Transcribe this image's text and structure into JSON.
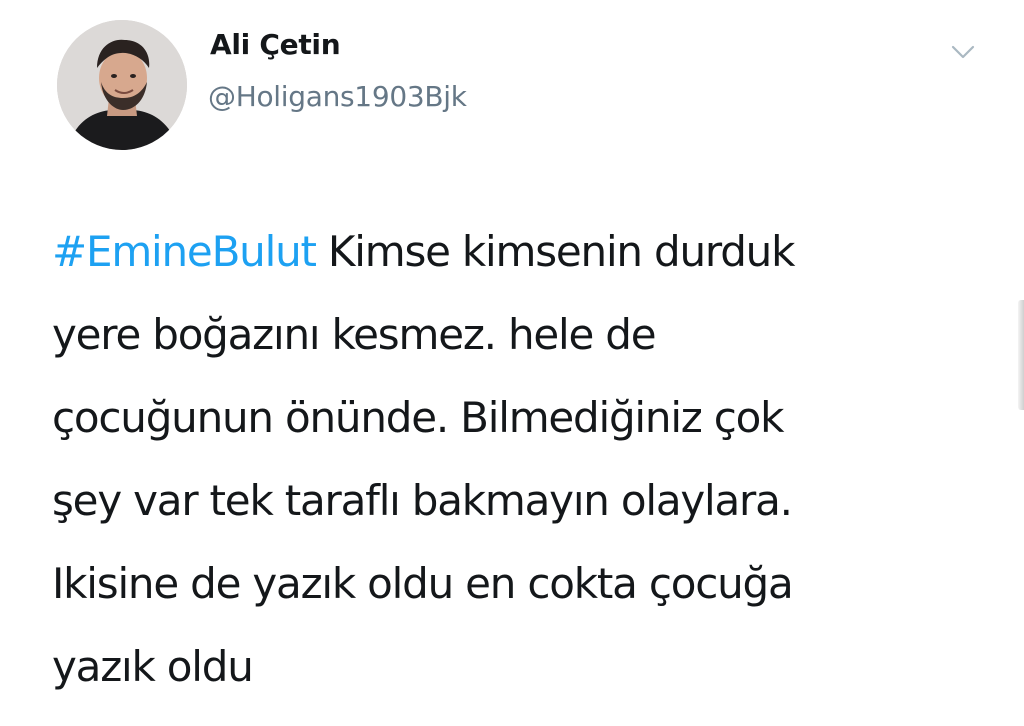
{
  "tweet": {
    "author": {
      "display_name": "Ali Çetin",
      "handle": "@Holigans1903Bjk",
      "avatar_icon": "profile-photo"
    },
    "menu_icon": "chevron-down-icon",
    "hashtag": "#EmineBulut",
    "text_lines": [
      " Kimse kimsenin durduk",
      "yere boğazını kesmez. hele de",
      "çocuğunun önünde. Bilmediğiniz çok",
      "şey var tek taraflı bakmayın olaylara.",
      "Ikisine de yazık oldu en cokta çocuğa",
      "yazık oldu"
    ]
  },
  "colors": {
    "text": "#14171a",
    "secondary": "#657786",
    "link": "#1da1f2",
    "background": "#ffffff"
  }
}
